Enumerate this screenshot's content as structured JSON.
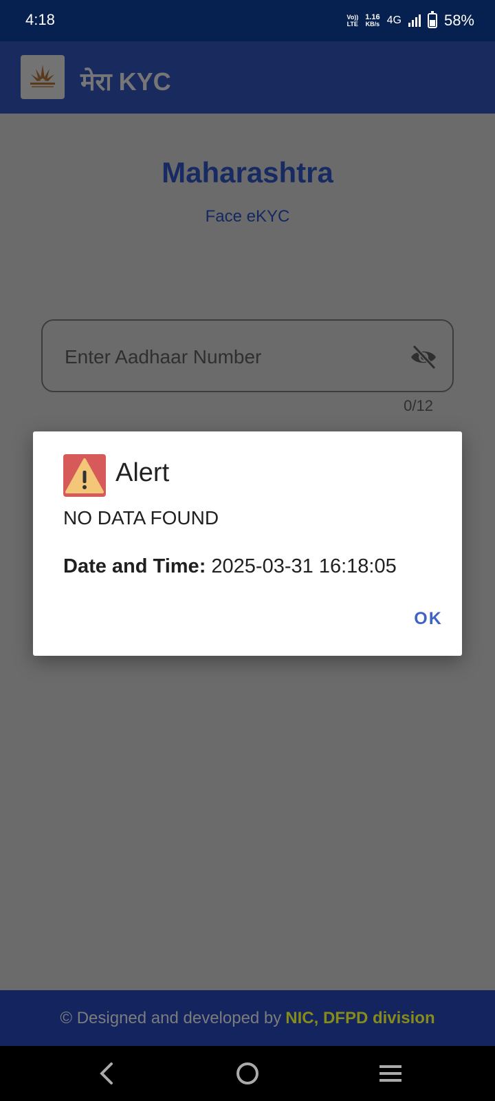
{
  "status_bar": {
    "time": "4:18",
    "volte_top": "Vo))",
    "volte_bottom": "LTE",
    "speed_value": "1.16",
    "speed_unit": "KB/s",
    "network": "4G",
    "battery_percent": "58%"
  },
  "app_bar": {
    "title": "मेरा KYC",
    "logo_icon": "garib-kalyan-anna-yojana-logo"
  },
  "main": {
    "state_title": "Maharashtra",
    "subtitle": "Face eKYC",
    "aadhaar_input": {
      "placeholder": "Enter Aadhaar Number",
      "value": "",
      "counter": "0/12",
      "toggle_icon": "eye-off-icon"
    }
  },
  "dialog": {
    "icon": "warning-icon",
    "title": "Alert",
    "message": "NO DATA FOUND",
    "datetime_label": "Date and Time:",
    "datetime_value": "2025-03-31 16:18:05",
    "ok_label": "OK"
  },
  "footer": {
    "prefix": "© Designed and developed by",
    "highlight": "NIC, DFPD division"
  },
  "colors": {
    "status_bar": "#06204f",
    "app_bar": "#192a5f",
    "accent_link": "#3e63c6",
    "footer_highlight": "#868b19"
  }
}
